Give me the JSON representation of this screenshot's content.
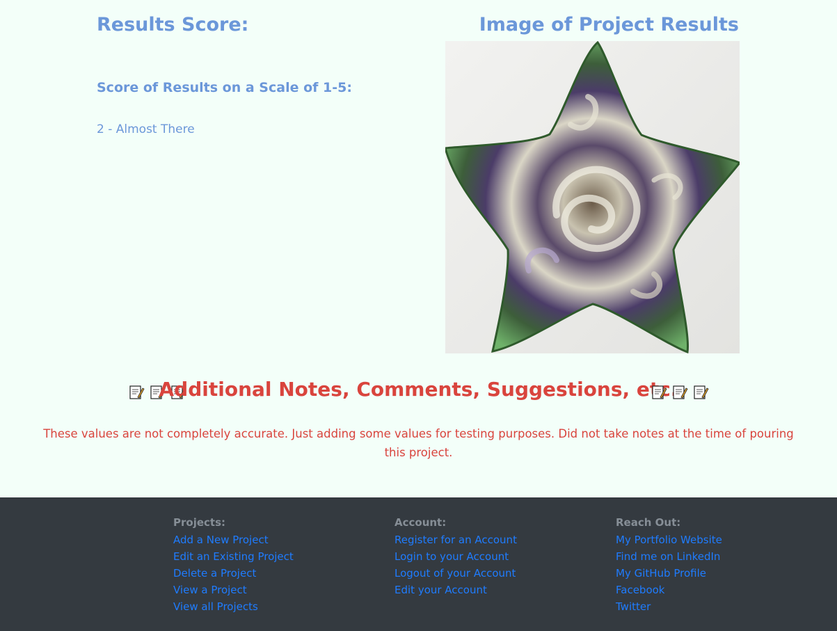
{
  "results": {
    "score_title": "Results Score:",
    "score_subtitle": "Score of Results on a Scale of 1-5:",
    "score_value": "2 - Almost There",
    "image_title": "Image of Project Results"
  },
  "notes": {
    "title": "Additional Notes, Comments, Suggestions, etc.",
    "icon": "memo-icon",
    "text": "These values are not completely accurate. Just adding some values for testing purposes. Did not take notes at the time of pouring this project."
  },
  "footer": {
    "projects": {
      "heading": "Projects:",
      "links": [
        "Add a New Project",
        "Edit an Existing Project",
        "Delete a Project",
        "View a Project",
        "View all Projects"
      ]
    },
    "account": {
      "heading": "Account:",
      "links": [
        "Register for an Account",
        "Login to your Account",
        "Logout of your Account",
        "Edit your Account"
      ]
    },
    "reach_out": {
      "heading": "Reach Out:",
      "links": [
        "My Portfolio Website",
        "Find me on LinkedIn",
        "My GitHub Profile",
        "Facebook",
        "Twitter"
      ]
    }
  },
  "colors": {
    "background": "#f3fff9",
    "heading_blue": "#6b97d9",
    "notes_red": "#d9443d",
    "footer_bg": "#343a40",
    "footer_heading": "#868e96",
    "footer_link": "#1f7cff"
  }
}
